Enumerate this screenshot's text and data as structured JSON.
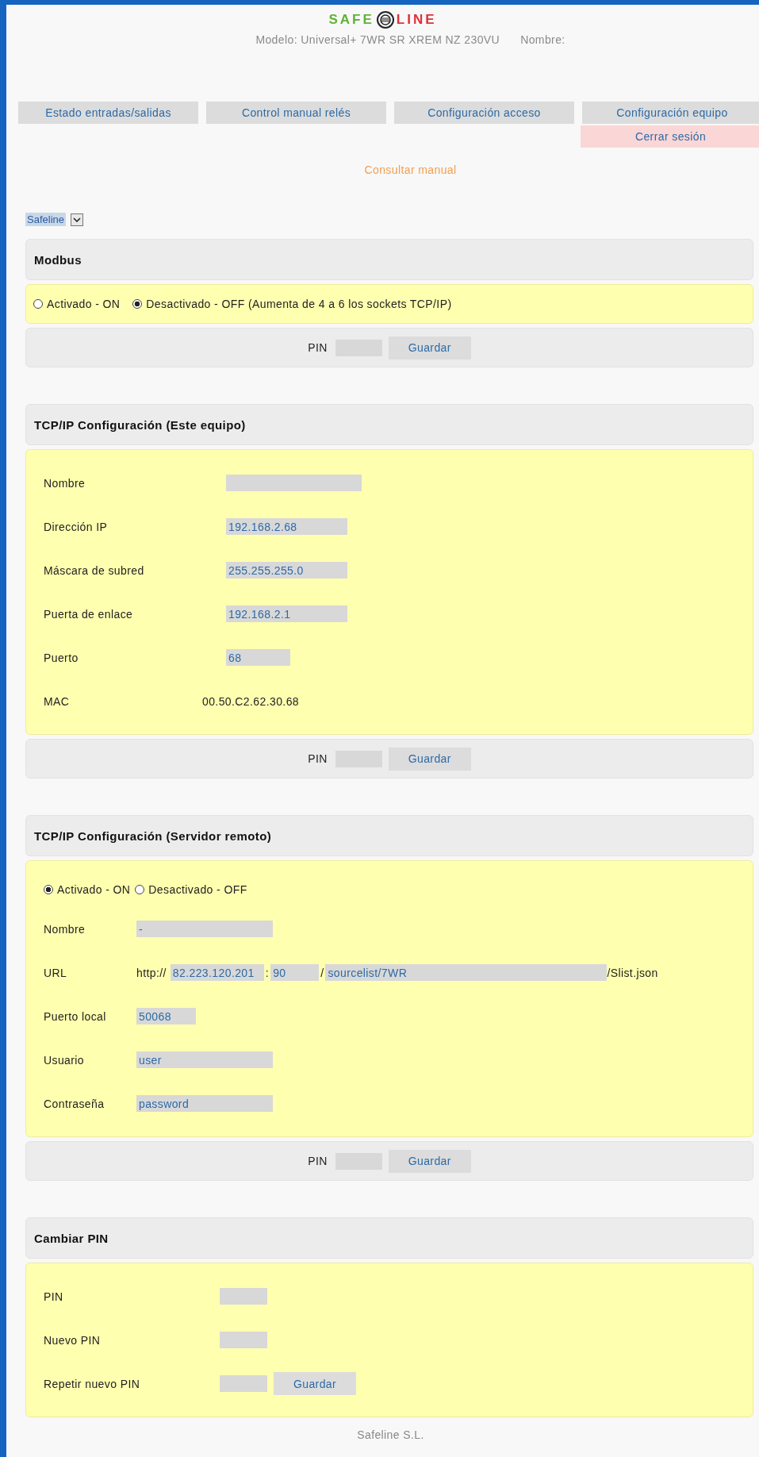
{
  "logo": {
    "left": "SAFE",
    "right": "LINE"
  },
  "model": {
    "text": "Modelo: Universal+ 7WR SR XREM NZ 230VU",
    "name_label": "Nombre:"
  },
  "tabs": [
    {
      "label": "Estado entradas/salidas",
      "selected": false
    },
    {
      "label": "Control manual relés",
      "selected": false
    },
    {
      "label": "Configuración acceso",
      "selected": false
    },
    {
      "label": "Configuración equipo",
      "selected": false
    }
  ],
  "logout": "Cerrar sesión",
  "manual_link": "Consultar manual",
  "selector": {
    "value": "Safeline"
  },
  "sections": [
    {
      "kind": "radio",
      "title": "Modbus",
      "options": [
        {
          "label": "Activado - ON",
          "selected": false
        },
        {
          "label": "Desactivado - OFF (Aumenta de 4 a 6 los sockets TCP/IP)",
          "selected": true
        }
      ],
      "pin_bar": {
        "label": "PIN",
        "button": "Guardar"
      }
    },
    {
      "kind": "form",
      "title": "TCP/IP Configuración (Este equipo)",
      "rows": [
        {
          "kind": "input",
          "label": "Nombre"
        },
        {
          "kind": "input",
          "label": "Dirección IP",
          "value": "192.168.2.68"
        },
        {
          "kind": "input",
          "label": "Máscara de subred",
          "value": "255.255.255.0"
        },
        {
          "kind": "input",
          "label": "Puerta de enlace",
          "value": "192.168.2.1"
        },
        {
          "kind": "input",
          "label": "Puerto",
          "value": "68"
        },
        {
          "kind": "text",
          "label": "MAC",
          "value": "00.50.C2.62.30.68"
        }
      ],
      "pin_bar": {
        "label": "PIN",
        "button": "Guardar"
      }
    },
    {
      "kind": "server",
      "title": "TCP/IP Configuración (Servidor remoto)",
      "options": [
        {
          "label": "Activado - ON",
          "selected": true
        },
        {
          "label": "Desactivado - OFF",
          "selected": false
        }
      ],
      "rows": [
        {
          "kind": "input",
          "label": "Nombre",
          "value": "-"
        },
        {
          "kind": "url",
          "label": "URL",
          "prefix": "http://",
          "host": "82.223.120.201",
          "port_sep": ":",
          "port": "90",
          "path_sep": "/",
          "path": "sourcelist/7WR",
          "suffix": "/Slist.json"
        },
        {
          "kind": "input",
          "label": "Puerto local",
          "value": "50068"
        },
        {
          "kind": "input",
          "label": "Usuario",
          "value": "user"
        },
        {
          "kind": "input",
          "label": "Contraseña",
          "value": "password"
        }
      ],
      "pin_bar": {
        "label": "PIN",
        "button": "Guardar"
      }
    },
    {
      "kind": "form",
      "title": "Cambiar PIN",
      "rows": [
        {
          "kind": "input",
          "label": "PIN"
        },
        {
          "kind": "input",
          "label": "Nuevo PIN"
        },
        {
          "kind": "input",
          "label": "Repetir nuevo PIN",
          "button": "Guardar"
        }
      ]
    }
  ],
  "footer": "Safeline S.L."
}
